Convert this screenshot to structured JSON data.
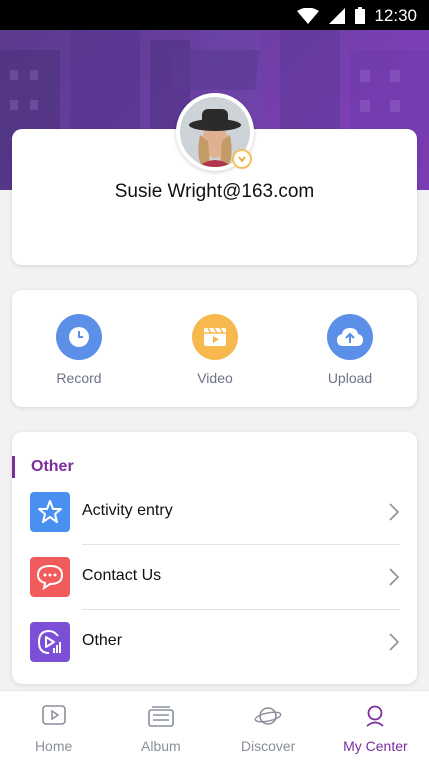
{
  "status_bar": {
    "time": "12:30"
  },
  "profile": {
    "username": "Susie Wright@163.com"
  },
  "actions": [
    {
      "label": "Record",
      "icon": "clock-icon",
      "color": "#5b8fe8"
    },
    {
      "label": "Video",
      "icon": "film-icon",
      "color": "#f7b84e"
    },
    {
      "label": "Upload",
      "icon": "cloud-upload-icon",
      "color": "#5b8fe8"
    }
  ],
  "other_section": {
    "title": "Other",
    "items": [
      {
        "label": "Activity entry",
        "icon": "star-icon",
        "color": "#4a90f0"
      },
      {
        "label": "Contact Us",
        "icon": "chat-bubble-icon",
        "color": "#f25b5b"
      },
      {
        "label": "Other",
        "icon": "play-stats-icon",
        "color": "#7b4fd6"
      }
    ]
  },
  "tabs": [
    {
      "label": "Home",
      "icon": "play-square-icon",
      "active": false
    },
    {
      "label": "Album",
      "icon": "album-icon",
      "active": false
    },
    {
      "label": "Discover",
      "icon": "planet-icon",
      "active": false
    },
    {
      "label": "My Center",
      "icon": "person-icon",
      "active": true
    }
  ],
  "colors": {
    "accent": "#7b2d9e",
    "banner": "#6a3fa2"
  }
}
